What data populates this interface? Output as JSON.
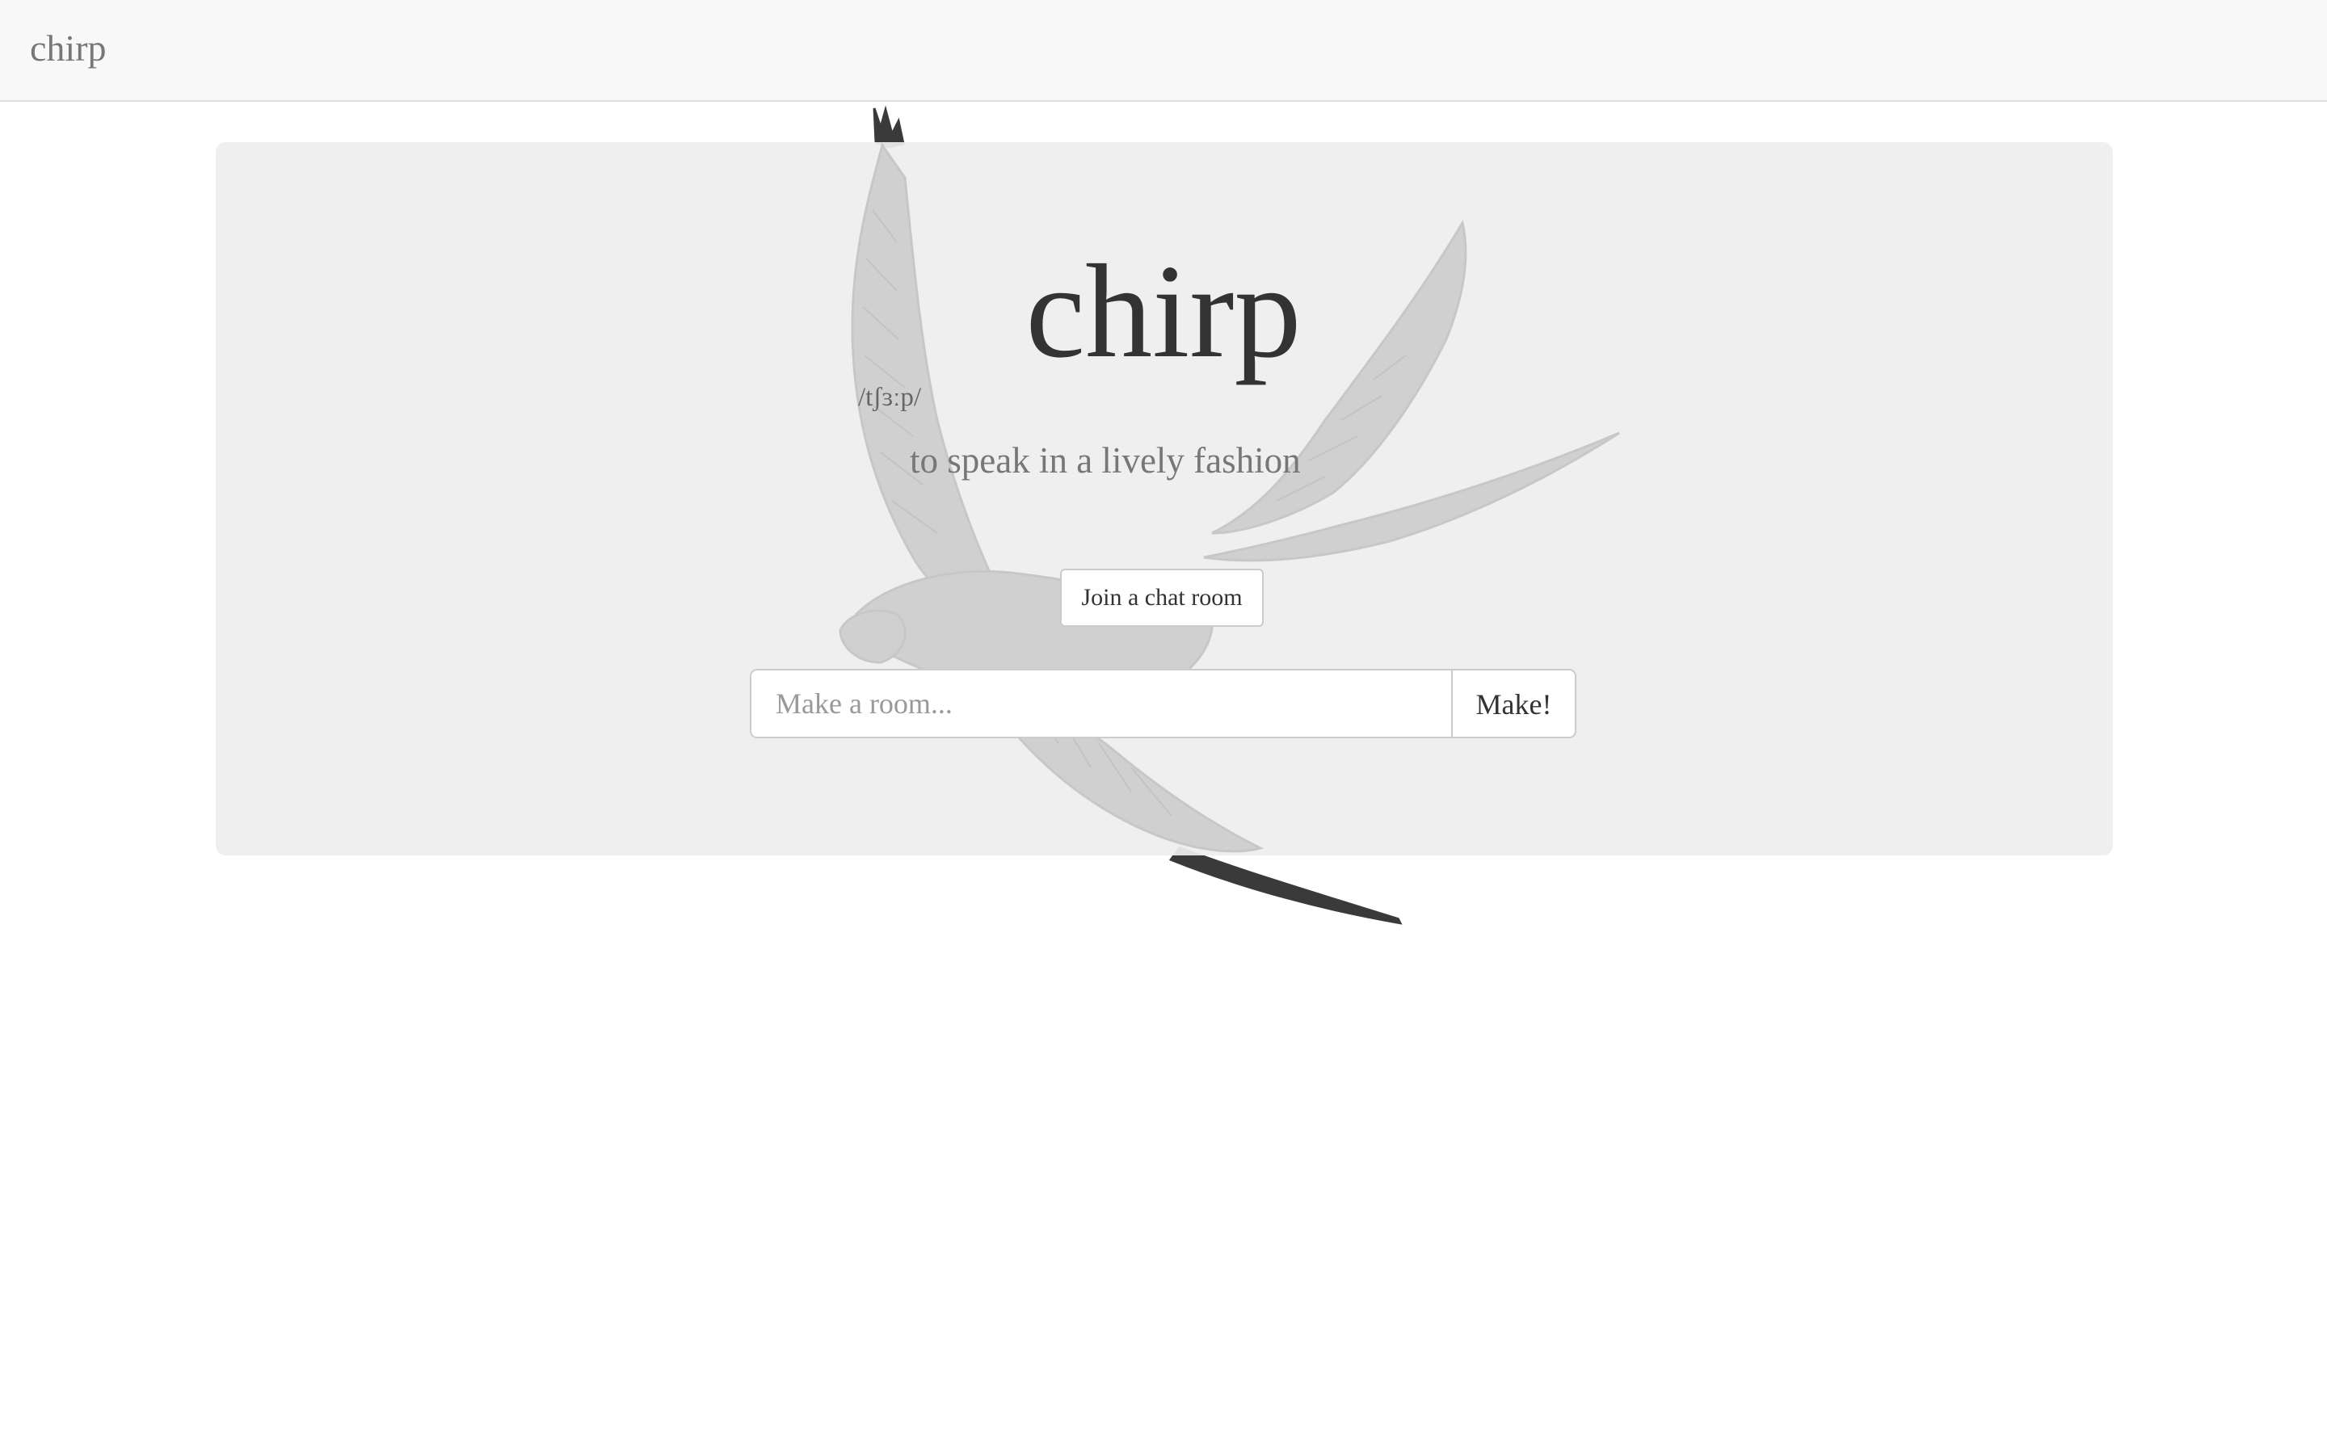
{
  "navbar": {
    "brand": "chirp"
  },
  "hero": {
    "title": "chirp",
    "pronunciation": "/tʃɜːp/",
    "definition": "to speak in a lively fashion",
    "join_label": "Join a chat room"
  },
  "make_room": {
    "placeholder": "Make a room...",
    "value": "",
    "button_label": "Make!"
  },
  "illustration": {
    "icon": "swallow-bird-illustration",
    "color": "#333333"
  }
}
